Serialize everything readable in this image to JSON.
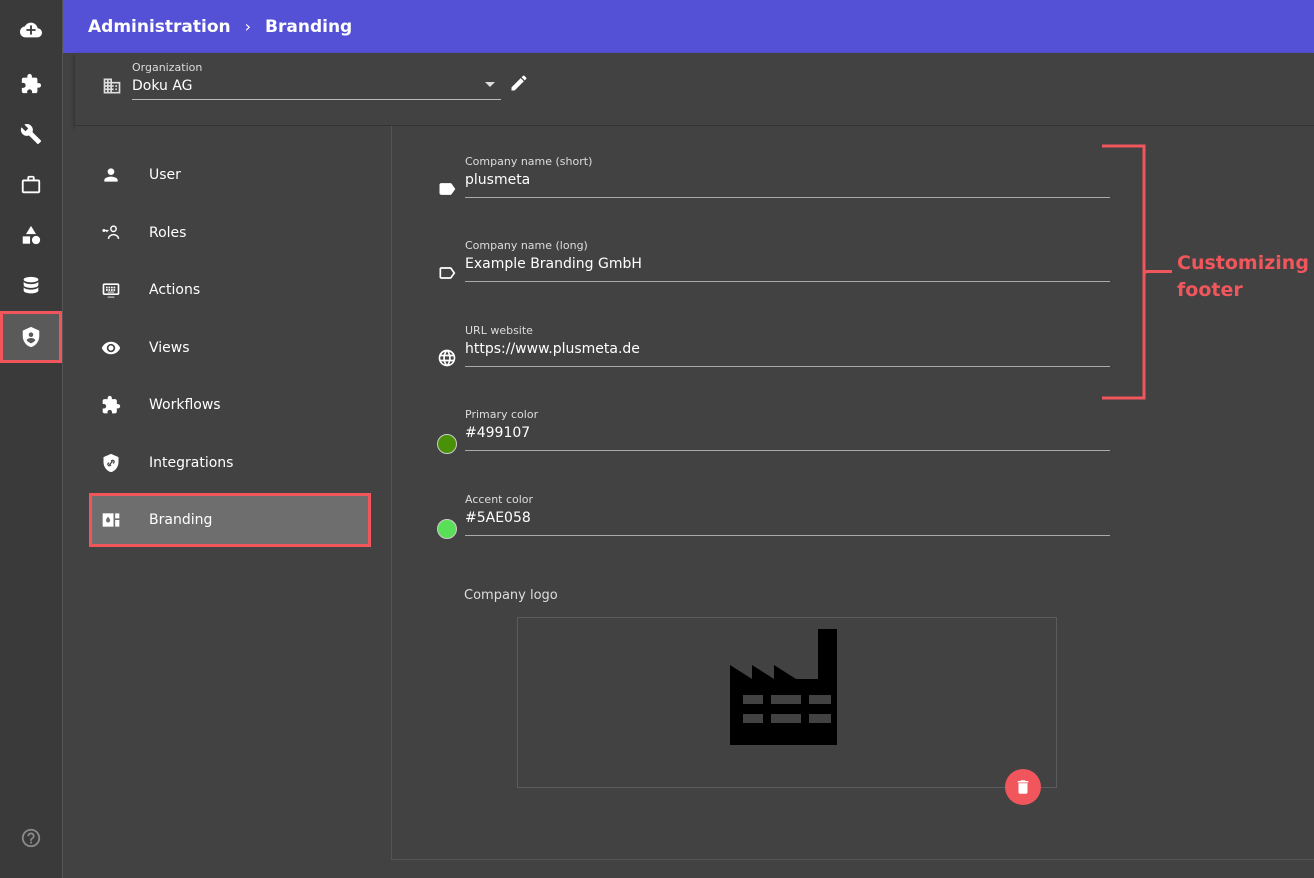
{
  "header": {
    "crumb_1": "Administration",
    "crumb_separator": "›",
    "crumb_2": "Branding"
  },
  "organization": {
    "label": "Organization",
    "value": "Doku AG"
  },
  "rail": {
    "items": [
      "cloud-add-icon",
      "puzzle-icon",
      "wrench-icon",
      "briefcase-icon",
      "shapes-icon",
      "database-icon",
      "admin-shield-icon"
    ],
    "active": "admin-shield-icon",
    "help_icon": "help-circle-icon"
  },
  "nav": {
    "items": [
      {
        "label": "User",
        "icon": "person-icon"
      },
      {
        "label": "Roles",
        "icon": "roles-icon"
      },
      {
        "label": "Actions",
        "icon": "keyboard-icon"
      },
      {
        "label": "Views",
        "icon": "eye-icon"
      },
      {
        "label": "Workflows",
        "icon": "puzzle-icon"
      },
      {
        "label": "Integrations",
        "icon": "shield-link-icon"
      },
      {
        "label": "Branding",
        "icon": "branding-icon"
      }
    ],
    "active": "Branding"
  },
  "form": {
    "company_short": {
      "label": "Company name (short)",
      "value": "plusmeta"
    },
    "company_long": {
      "label": "Company name (long)",
      "value": "Example Branding GmbH"
    },
    "url": {
      "label": "URL website",
      "value": "https://www.plusmeta.de"
    },
    "primary_color": {
      "label": "Primary color",
      "value": "#499107"
    },
    "accent_color": {
      "label": "Accent color",
      "value": "#5AE058"
    },
    "logo_label": "Company logo"
  },
  "annotation": {
    "text": "Customizing footer",
    "color": "#f0565c"
  },
  "colors": {
    "header_bg": "#5451d6",
    "highlight": "#f0565c",
    "panel_bg": "#424242"
  }
}
